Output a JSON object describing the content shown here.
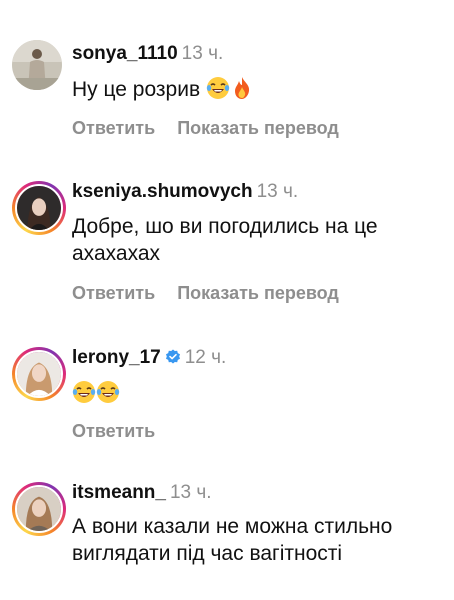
{
  "comments": [
    {
      "username": "sonya_1110",
      "time": "13 ч.",
      "text": "Ну це розрив",
      "text_emojis": [
        "laughing-tears-emoji",
        "fire-emoji"
      ],
      "reply_label": "Ответить",
      "translate_label": "Показать перевод"
    },
    {
      "username": "kseniya.shumovych",
      "time": "13 ч.",
      "text": "Добре, шо ви погодились на це ахахахах",
      "reply_label": "Ответить",
      "translate_label": "Показать перевод"
    },
    {
      "username": "lerony_17",
      "verified": true,
      "time": "12 ч.",
      "text": "",
      "text_emojis": [
        "laughing-tears-emoji",
        "laughing-tears-emoji"
      ],
      "reply_label": "Ответить"
    },
    {
      "username": "itsmeann_",
      "time": "13 ч.",
      "text": "А вони казали не можна стильно виглядати під час вагітності"
    }
  ],
  "colors": {
    "text": "#111111",
    "secondary": "#8e8e8e",
    "verified": "#3897f0"
  }
}
